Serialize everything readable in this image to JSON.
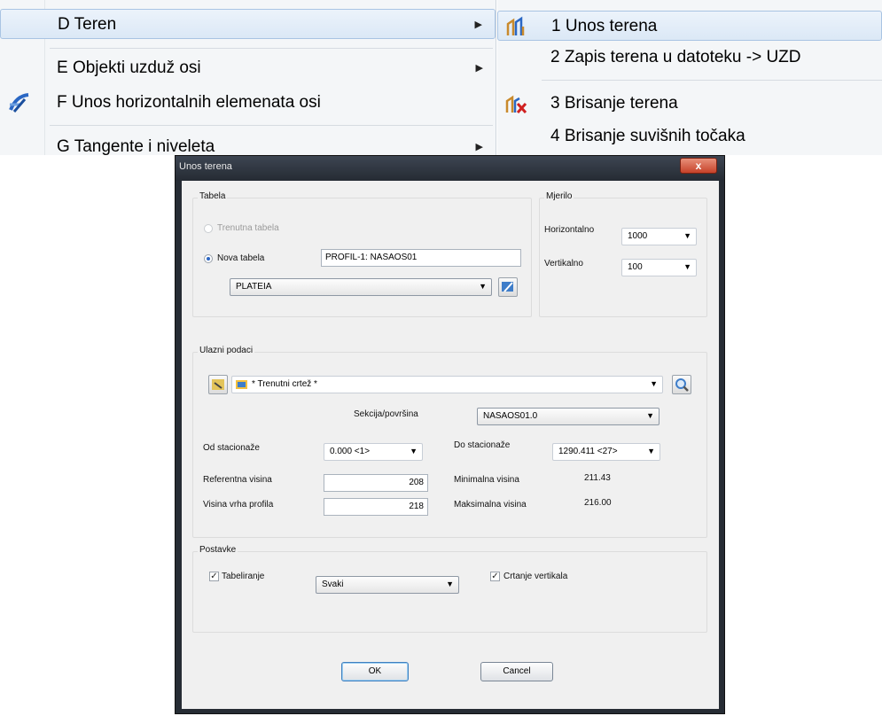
{
  "menu_left": {
    "items": [
      {
        "label": "D Teren",
        "has_submenu": true,
        "highlighted": true
      },
      {
        "label": "E Objekti uzduž osi",
        "has_submenu": true
      },
      {
        "label": "F Unos horizontalnih elemenata osi",
        "has_submenu": false,
        "icon": "axis-elements-icon"
      },
      {
        "label": "G Tangente i niveleta",
        "has_submenu": true
      }
    ]
  },
  "menu_right": {
    "items": [
      {
        "label": "1 Unos terena",
        "icon": "terrain-input-icon",
        "highlighted": true
      },
      {
        "label": "2 Zapis terena u datoteku -> UZD"
      },
      {
        "label": "3 Brisanje terena",
        "icon": "terrain-delete-icon"
      },
      {
        "label": "4 Brisanje suvišnih točaka"
      }
    ]
  },
  "dialog": {
    "title": "Unos terena",
    "close_label": "x",
    "tabela": {
      "group_label": "Tabela",
      "trenutna_label": "Trenutna tabela",
      "nova_label": "Nova tabela",
      "nova_value": "PROFIL-1: NASAOS01",
      "type_value": "PLATEIA"
    },
    "mjerilo": {
      "group_label": "Mjerilo",
      "horizontal_label": "Horizontalno",
      "horizontal_value": "1000",
      "vertical_label": "Vertikalno",
      "vertical_value": "100"
    },
    "ulazni": {
      "group_label": "Ulazni podaci",
      "source_value": "* Trenutni crtež *",
      "sekcija_label": "Sekcija/površina",
      "sekcija_value": "NASAOS01.0",
      "od_label": "Od stacionaže",
      "od_value": "0.000 <1>",
      "do_label": "Do stacionaže",
      "do_value": "1290.411 <27>",
      "ref_label": "Referentna visina",
      "ref_value": "208",
      "vrh_label": "Visina vrha profila",
      "vrh_value": "218",
      "min_label": "Minimalna visina",
      "min_value": "211.43",
      "max_label": "Maksimalna visina",
      "max_value": "216.00"
    },
    "postavke": {
      "group_label": "Postavke",
      "tabeliranje_label": "Tabeliranje",
      "tabeliranje_value": "Svaki",
      "crtanje_label": "Crtanje vertikala"
    },
    "ok_label": "OK",
    "cancel_label": "Cancel"
  }
}
